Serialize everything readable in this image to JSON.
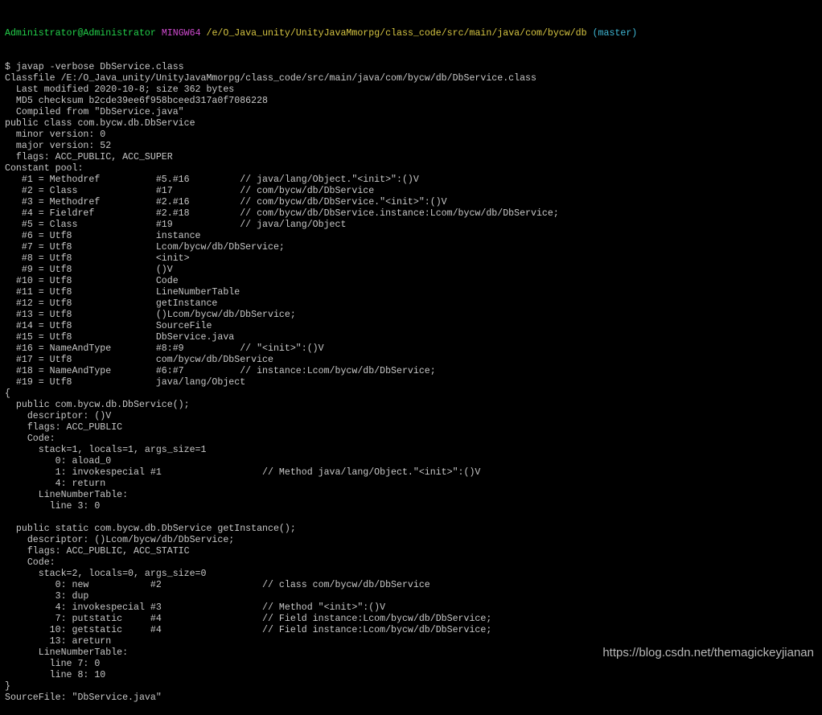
{
  "prompt": {
    "user": "Administrator@Administrator",
    "host": "MINGW64",
    "path": "/e/O_Java_unity/UnityJavaMmorpg/class_code/src/main/java/com/bycw/db",
    "branch": "(master)"
  },
  "colors": {
    "background": "#000000",
    "text": "#c8c8c8",
    "prompt_user": "#23d14b",
    "prompt_host": "#d14bd1",
    "prompt_path": "#d6c542",
    "prompt_branch": "#3fb8d6"
  },
  "output_lines": [
    "$ javap -verbose DbService.class",
    "Classfile /E:/O_Java_unity/UnityJavaMmorpg/class_code/src/main/java/com/bycw/db/DbService.class",
    "  Last modified 2020-10-8; size 362 bytes",
    "  MD5 checksum b2cde39ee6f958bceed317a0f7086228",
    "  Compiled from \"DbService.java\"",
    "public class com.bycw.db.DbService",
    "  minor version: 0",
    "  major version: 52",
    "  flags: ACC_PUBLIC, ACC_SUPER",
    "Constant pool:",
    "   #1 = Methodref          #5.#16         // java/lang/Object.\"<init>\":()V",
    "   #2 = Class              #17            // com/bycw/db/DbService",
    "   #3 = Methodref          #2.#16         // com/bycw/db/DbService.\"<init>\":()V",
    "   #4 = Fieldref           #2.#18         // com/bycw/db/DbService.instance:Lcom/bycw/db/DbService;",
    "   #5 = Class              #19            // java/lang/Object",
    "   #6 = Utf8               instance",
    "   #7 = Utf8               Lcom/bycw/db/DbService;",
    "   #8 = Utf8               <init>",
    "   #9 = Utf8               ()V",
    "  #10 = Utf8               Code",
    "  #11 = Utf8               LineNumberTable",
    "  #12 = Utf8               getInstance",
    "  #13 = Utf8               ()Lcom/bycw/db/DbService;",
    "  #14 = Utf8               SourceFile",
    "  #15 = Utf8               DbService.java",
    "  #16 = NameAndType        #8:#9          // \"<init>\":()V",
    "  #17 = Utf8               com/bycw/db/DbService",
    "  #18 = NameAndType        #6:#7          // instance:Lcom/bycw/db/DbService;",
    "  #19 = Utf8               java/lang/Object",
    "{",
    "  public com.bycw.db.DbService();",
    "    descriptor: ()V",
    "    flags: ACC_PUBLIC",
    "    Code:",
    "      stack=1, locals=1, args_size=1",
    "         0: aload_0",
    "         1: invokespecial #1                  // Method java/lang/Object.\"<init>\":()V",
    "         4: return",
    "      LineNumberTable:",
    "        line 3: 0",
    "",
    "  public static com.bycw.db.DbService getInstance();",
    "    descriptor: ()Lcom/bycw/db/DbService;",
    "    flags: ACC_PUBLIC, ACC_STATIC",
    "    Code:",
    "      stack=2, locals=0, args_size=0",
    "         0: new           #2                  // class com/bycw/db/DbService",
    "         3: dup",
    "         4: invokespecial #3                  // Method \"<init>\":()V",
    "         7: putstatic     #4                  // Field instance:Lcom/bycw/db/DbService;",
    "        10: getstatic     #4                  // Field instance:Lcom/bycw/db/DbService;",
    "        13: areturn",
    "      LineNumberTable:",
    "        line 7: 0",
    "        line 8: 10",
    "}",
    "SourceFile: \"DbService.java\""
  ],
  "watermark": "https://blog.csdn.net/themagickeyjianan"
}
